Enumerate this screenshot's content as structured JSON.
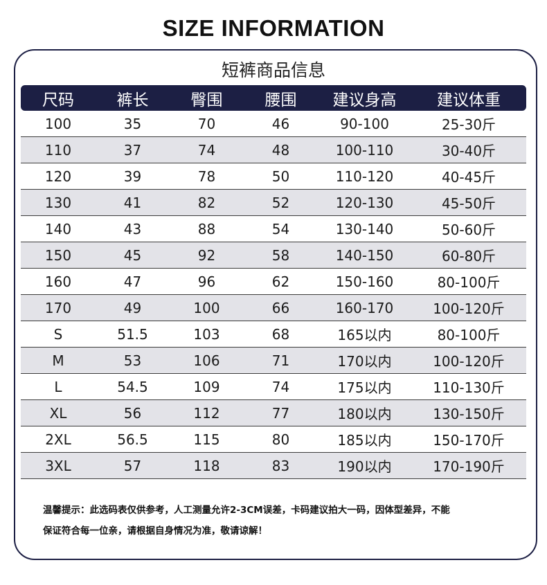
{
  "title": "SIZE INFORMATION",
  "subtitle": "短裤商品信息",
  "table": {
    "headers": [
      "尺码",
      "裤长",
      "臀围",
      "腰围",
      "建议身高",
      "建议体重"
    ],
    "rows": [
      [
        "100",
        "35",
        "70",
        "46",
        "90-100",
        "25-30斤"
      ],
      [
        "110",
        "37",
        "74",
        "48",
        "100-110",
        "30-40斤"
      ],
      [
        "120",
        "39",
        "78",
        "50",
        "110-120",
        "40-45斤"
      ],
      [
        "130",
        "41",
        "82",
        "52",
        "120-130",
        "45-50斤"
      ],
      [
        "140",
        "43",
        "88",
        "54",
        "130-140",
        "50-60斤"
      ],
      [
        "150",
        "45",
        "92",
        "58",
        "140-150",
        "60-80斤"
      ],
      [
        "160",
        "47",
        "96",
        "62",
        "150-160",
        "80-100斤"
      ],
      [
        "170",
        "49",
        "100",
        "66",
        "160-170",
        "100-120斤"
      ],
      [
        "S",
        "51.5",
        "103",
        "68",
        "165以内",
        "80-100斤"
      ],
      [
        "M",
        "53",
        "106",
        "71",
        "170以内",
        "100-120斤"
      ],
      [
        "L",
        "54.5",
        "109",
        "74",
        "175以内",
        "110-130斤"
      ],
      [
        "XL",
        "56",
        "112",
        "77",
        "180以内",
        "130-150斤"
      ],
      [
        "2XL",
        "56.5",
        "115",
        "80",
        "185以内",
        "150-170斤"
      ],
      [
        "3XL",
        "57",
        "118",
        "83",
        "190以内",
        "170-190斤"
      ]
    ]
  },
  "note": {
    "line1": "温馨提示：此选码表仅供参考，人工测量允许2-3CM误差，卡码建议拍大一码，因体型差异，不能",
    "line2": "保证符合每一位亲，请根据自身情况为准，敬请谅解！"
  },
  "colors": {
    "header_bg": "#1c1f44",
    "stripe_bg": "#e3e3e8",
    "frame": "#1c1f44"
  }
}
